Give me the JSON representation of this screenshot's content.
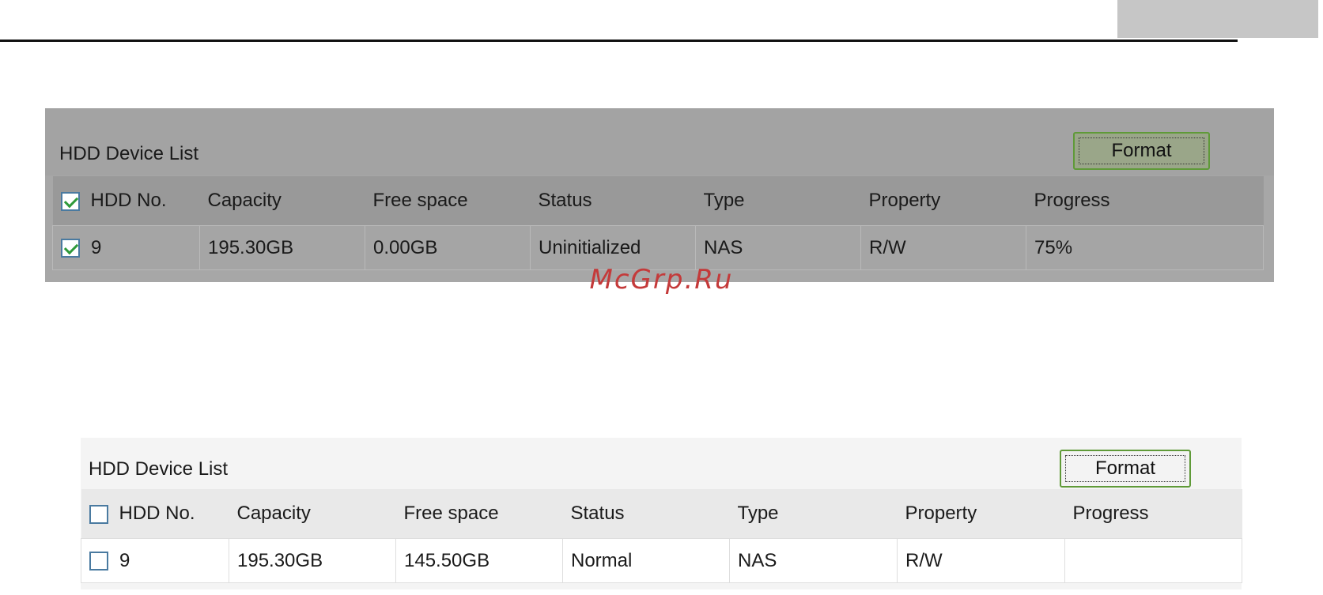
{
  "watermark": "McGrp.Ru",
  "panels": [
    {
      "title": "HDD Device List",
      "format_label": "Format",
      "columns": [
        "HDD No.",
        "Capacity",
        "Free space",
        "Status",
        "Type",
        "Property",
        "Progress"
      ],
      "header_checked": true,
      "rows": [
        {
          "checked": true,
          "hdd_no": "9",
          "capacity": "195.30GB",
          "free_space": "0.00GB",
          "status": "Uninitialized",
          "type": "NAS",
          "property": "R/W",
          "progress": "75%"
        }
      ]
    },
    {
      "title": "HDD Device List",
      "format_label": "Format",
      "columns": [
        "HDD No.",
        "Capacity",
        "Free space",
        "Status",
        "Type",
        "Property",
        "Progress"
      ],
      "header_checked": false,
      "rows": [
        {
          "checked": false,
          "hdd_no": "9",
          "capacity": "195.30GB",
          "free_space": "145.50GB",
          "status": "Normal",
          "type": "NAS",
          "property": "R/W",
          "progress": ""
        }
      ]
    }
  ]
}
